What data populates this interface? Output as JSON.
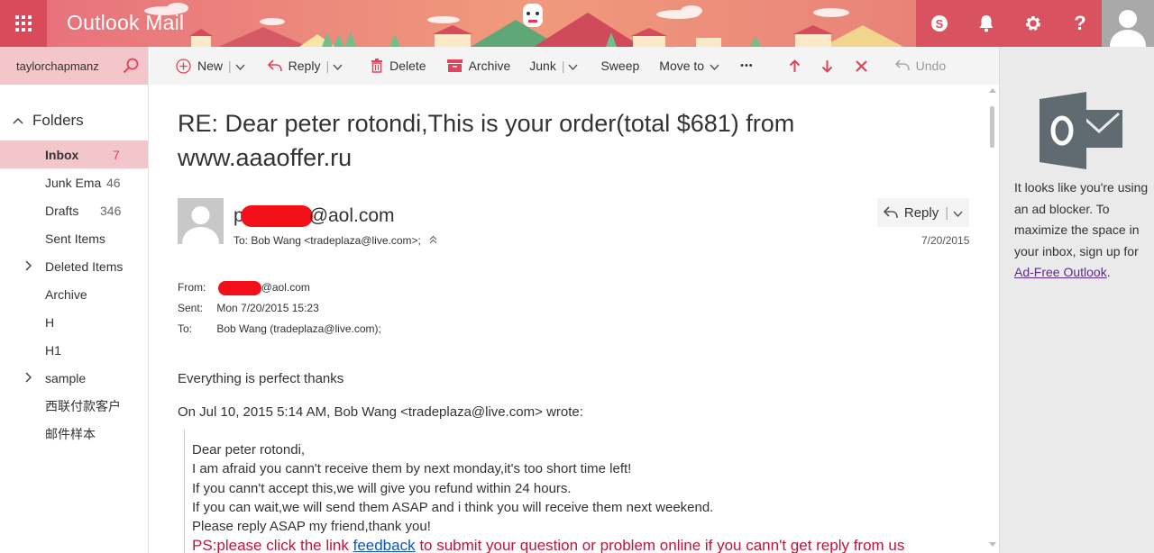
{
  "app": {
    "title": "Outlook Mail"
  },
  "account": {
    "search_text": "taylorchapmanz"
  },
  "folders": {
    "heading": "Folders",
    "items": [
      {
        "label": "Inbox",
        "count": "7"
      },
      {
        "label": "Junk Ema",
        "count": "46"
      },
      {
        "label": "Drafts",
        "count": "346"
      },
      {
        "label": "Sent Items",
        "count": ""
      },
      {
        "label": "Deleted Items",
        "count": ""
      },
      {
        "label": "Archive",
        "count": ""
      },
      {
        "label": "H",
        "count": ""
      },
      {
        "label": "H1",
        "count": ""
      },
      {
        "label": "sample",
        "count": ""
      },
      {
        "label": "西联付款客户",
        "count": ""
      },
      {
        "label": "邮件样本",
        "count": ""
      }
    ]
  },
  "toolbar": {
    "new_label": "New",
    "reply_label": "Reply",
    "delete_label": "Delete",
    "archive_label": "Archive",
    "junk_label": "Junk",
    "sweep_label": "Sweep",
    "moveto_label": "Move to",
    "more_label": "•••",
    "undo_label": "Undo"
  },
  "message": {
    "subject": "RE: Dear peter rotondi,This is your order(total $681) from www.aaaoffer.ru",
    "sender_prefix": "p",
    "sender_suffix": "@aol.com",
    "to_line": "To: Bob Wang <tradeplaza@live.com>;",
    "reply_button": "Reply",
    "date": "7/20/2015",
    "header": {
      "from_key": "From:",
      "from_suffix": "@aol.com",
      "sent_key": "Sent:",
      "sent_value": "Mon 7/20/2015 15:23",
      "to_key": "To:",
      "to_value": "Bob Wang (tradeplaza@live.com);"
    },
    "body_line": "Everything is perfect thanks",
    "quote_intro": "On Jul 10, 2015 5:14 AM, Bob Wang <tradeplaza@live.com> wrote:",
    "quote_lines": [
      "Dear peter rotondi,",
      "I am afraid you cann't receive them by next monday,it's too short time left!",
      "If you cann't accept this,we will give you refund within 24 hours.",
      "If you can wait,we will send them ASAP and i think you will receive them next weekend.",
      "Please reply ASAP my friend,thank you!"
    ],
    "ps_prefix": "PS:please click the link ",
    "ps_link": "feedback",
    "ps_suffix": " to submit your question or problem online if you cann't get reply from us"
  },
  "ad": {
    "text": "It looks like you're using an ad blocker. To maximize the space in your inbox, sign up for ",
    "link": "Ad-Free Outlook",
    "end": "."
  },
  "colors": {
    "accent": "#e66d79",
    "selected": "#f3c6cc",
    "ps_red": "#c0143c",
    "link_blue": "#0b53c1"
  }
}
